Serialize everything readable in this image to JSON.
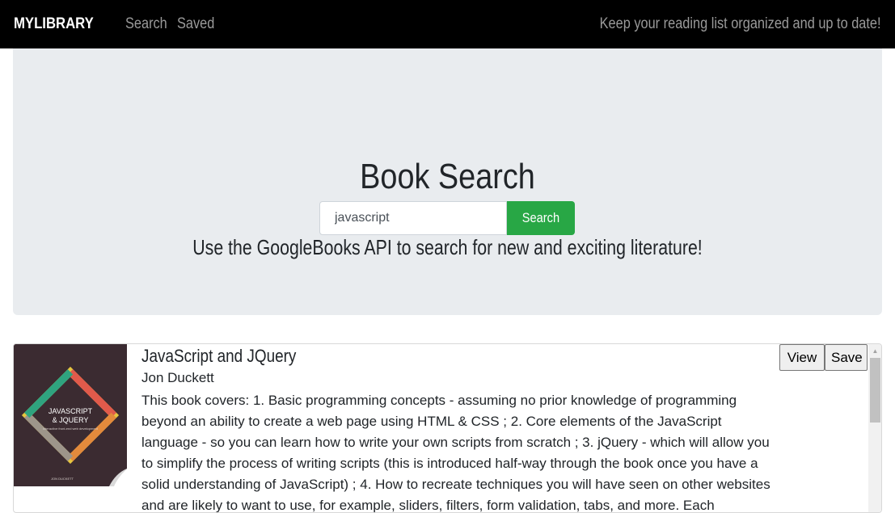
{
  "navbar": {
    "brand": "MYLIBRARY",
    "links": [
      "Search",
      "Saved"
    ],
    "tagline": "Keep your reading list organized and up to date!"
  },
  "jumbotron": {
    "title": "Book Search",
    "search": {
      "value": "javascript",
      "button_label": "Search"
    },
    "subtitle": "Use the GoogleBooks API to search for new and exciting literature!"
  },
  "results": [
    {
      "title": "JavaScript and JQuery",
      "author": "Jon Duckett",
      "description": "This book covers: 1. Basic programming concepts - assuming no prior knowledge of programming beyond an ability to create a web page using HTML & CSS ; 2. Core elements of the JavaScript language - so you can learn how to write your own scripts from scratch ; 3. jQuery - which will allow you to simplify the process of writing scripts (this is introduced half-way through the book once you have a solid understanding of JavaScript) ; 4. How to recreate techniques you will have seen on other websites and are likely to want to use, for example, sliders, filters, form validation, tabs, and more. Each",
      "cover": {
        "line1": "JAVASCRIPT",
        "line2": "& JQUERY",
        "tagline": "interactive front-end web development",
        "author_small": "JON DUCKETT"
      },
      "view_label": "View",
      "save_label": "Save"
    }
  ],
  "colors": {
    "navbar_bg": "#000000",
    "jumbotron_bg": "#e9ecef",
    "search_button": "#28a745",
    "cover_bg": "#3b2b31"
  }
}
